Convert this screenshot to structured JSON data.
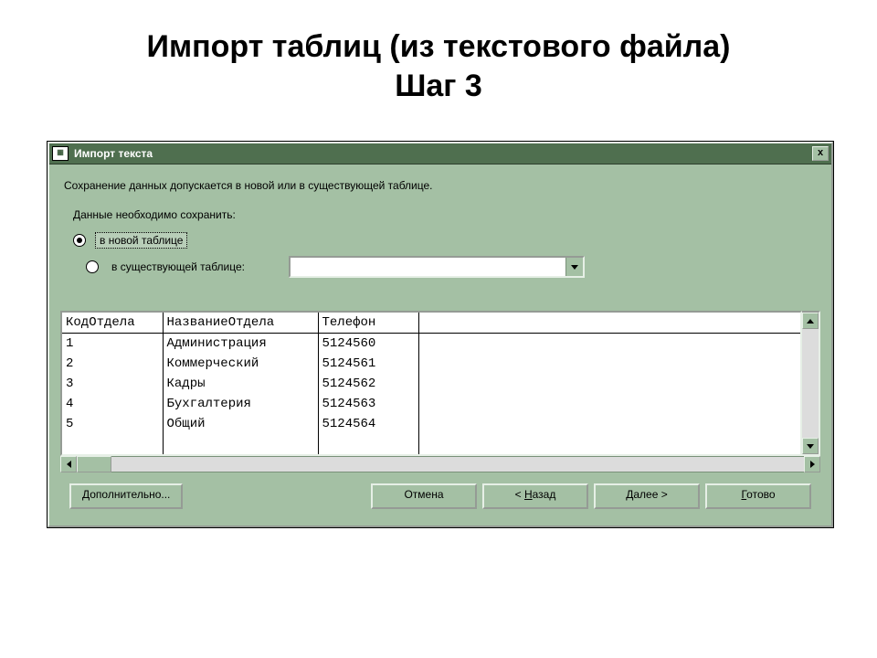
{
  "heading": {
    "line1": "Импорт таблиц (из текстового файла)",
    "line2": "Шаг 3"
  },
  "dialog": {
    "title": "Импорт текста",
    "description": "Сохранение данных допускается в новой или в существующей таблице.",
    "prompt": "Данные необходимо сохранить:",
    "radio_new_label": "в новой таблице",
    "radio_existing_label": "в существующей таблице:",
    "radio_selected": "new",
    "combo_value": ""
  },
  "preview": {
    "columns": [
      "КодОтдела",
      "НазваниеОтдела",
      "Телефон"
    ],
    "rows": [
      [
        "1",
        "Администрация",
        "5124560"
      ],
      [
        "2",
        "Коммерческий",
        "5124561"
      ],
      [
        "3",
        "Кадры",
        "5124562"
      ],
      [
        "4",
        "Бухгалтерия",
        "5124563"
      ],
      [
        "5",
        "Общий",
        "5124564"
      ]
    ]
  },
  "buttons": {
    "additional": "Дополнительно...",
    "cancel": "Отмена",
    "back_pre": "< ",
    "back_u": "Н",
    "back_post": "азад",
    "next_u": "Д",
    "next_post": "алее >",
    "finish_u": "Г",
    "finish_post": "отово"
  }
}
